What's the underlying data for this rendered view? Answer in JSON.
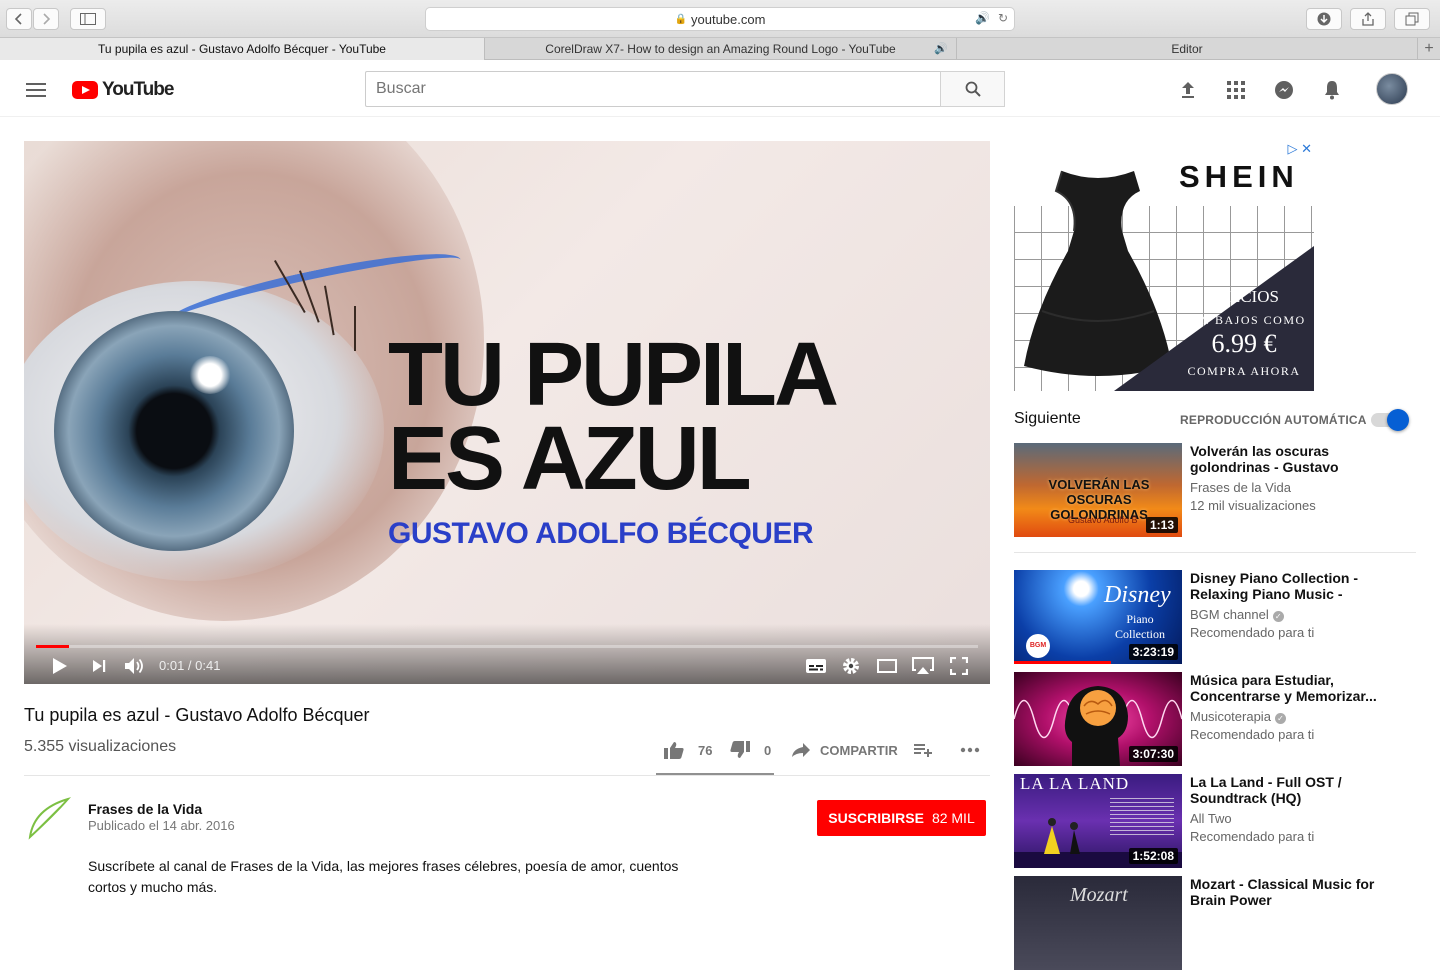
{
  "browser": {
    "url": "youtube.com",
    "tabs": [
      {
        "label": "Tu pupila es azul - Gustavo Adolfo Bécquer - YouTube",
        "active": true
      },
      {
        "label": "CorelDraw X7- How to design an Amazing Round Logo - YouTube",
        "active": false,
        "audio": true
      },
      {
        "label": "Editor",
        "active": false
      }
    ]
  },
  "header": {
    "logo_text": "YouTube",
    "search_placeholder": "Buscar"
  },
  "player": {
    "overlay_line1": "TU PUPILA",
    "overlay_line2": "ES AZUL",
    "overlay_author": "GUSTAVO ADOLFO BÉCQUER",
    "time_display": "0:01 / 0:41",
    "progress": 0.035
  },
  "video": {
    "title": "Tu pupila es azul - Gustavo Adolfo Bécquer",
    "views": "5.355 visualizaciones",
    "likes": "76",
    "dislikes": "0",
    "share_label": "COMPARTIR"
  },
  "channel": {
    "name": "Frases de la Vida",
    "published": "Publicado el 14 abr. 2016",
    "subscribe_label": "SUSCRIBIRSE",
    "subscriber_count": "82 MIL",
    "description": "Suscríbete al canal de Frases de la Vida, las mejores frases célebres, poesía de amor, cuentos cortos y mucho más."
  },
  "ad": {
    "brand": "SHEIN",
    "line1": "PRECIOS",
    "line2": "TAN BAJOS COMO",
    "price": "6.99 €",
    "cta": "COMPRA AHORA"
  },
  "sidebar": {
    "next_label": "Siguiente",
    "autoplay_label": "REPRODUCCIÓN AUTOMÁTICA",
    "items": [
      {
        "title": "Volverán las oscuras golondrinas - Gustavo Adolfo...",
        "channel": "Frases de la Vida",
        "meta": "12 mil visualizaciones",
        "duration": "1:13",
        "verified": false,
        "thumb_text": "VOLVERÁN LAS OSCURAS GOLONDRINAS",
        "thumb_sub": "Gustavo Adolfo B"
      },
      {
        "title": "Disney Piano Collection - Relaxing Piano Music - Music...",
        "channel": "BGM channel",
        "meta": "Recomendado para ti",
        "duration": "3:23:19",
        "verified": true,
        "thumb_text": "Disney",
        "thumb_sub": "Piano Collection",
        "thumb_badge": "BGM"
      },
      {
        "title": "Música para Estudiar, Concentrarse y Memorizar...",
        "channel": "Musicoterapia",
        "meta": "Recomendado para ti",
        "duration": "3:07:30",
        "verified": true
      },
      {
        "title": "La La Land - Full OST / Soundtrack (HQ)",
        "channel": "All Two",
        "meta": "Recomendado para ti",
        "duration": "1:52:08",
        "verified": false,
        "thumb_text": "LA LA LAND"
      },
      {
        "title": "Mozart - Classical Music for Brain Power",
        "channel": "",
        "meta": "",
        "duration": "",
        "verified": false,
        "thumb_text": "Mozart"
      }
    ]
  },
  "colors": {
    "youtube_red": "#ff0000",
    "toggle_blue": "#065fd4",
    "overlay_author_blue": "#2a3fc8"
  }
}
